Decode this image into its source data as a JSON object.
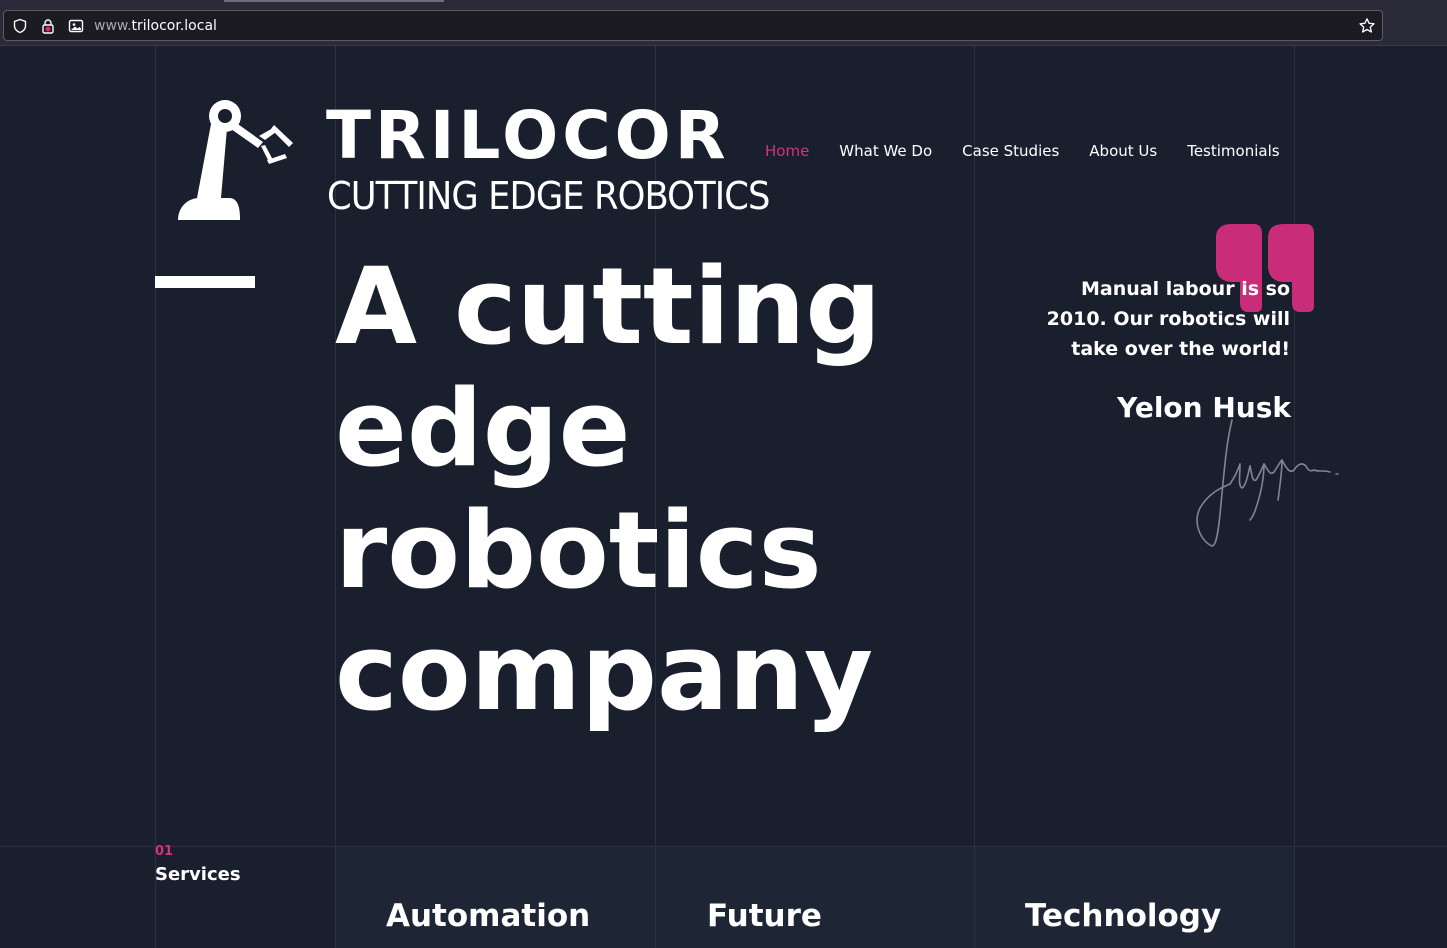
{
  "browser": {
    "url_prefix": "www.",
    "url_domain": "trilocor.local"
  },
  "logo": {
    "title": "TRILOCOR",
    "subtitle": "CUTTING EDGE ROBOTICS"
  },
  "nav": {
    "items": [
      {
        "label": "Home",
        "active": true
      },
      {
        "label": "What We Do",
        "active": false
      },
      {
        "label": "Case Studies",
        "active": false
      },
      {
        "label": "About Us",
        "active": false
      },
      {
        "label": "Testimonials",
        "active": false
      }
    ]
  },
  "hero": {
    "line1": "A cutting",
    "line2": "edge",
    "line3": "robotics",
    "line4": "company"
  },
  "quote": {
    "text": "Manual labour is so 2010. Our robotics will take over the world!",
    "author": "Yelon Husk"
  },
  "services": {
    "number": "01",
    "label": "Services",
    "columns": [
      "Automation",
      "Future",
      "Technology"
    ]
  },
  "colors": {
    "background": "#1a1f2e",
    "accent": "#d1337d",
    "text": "#ffffff"
  }
}
